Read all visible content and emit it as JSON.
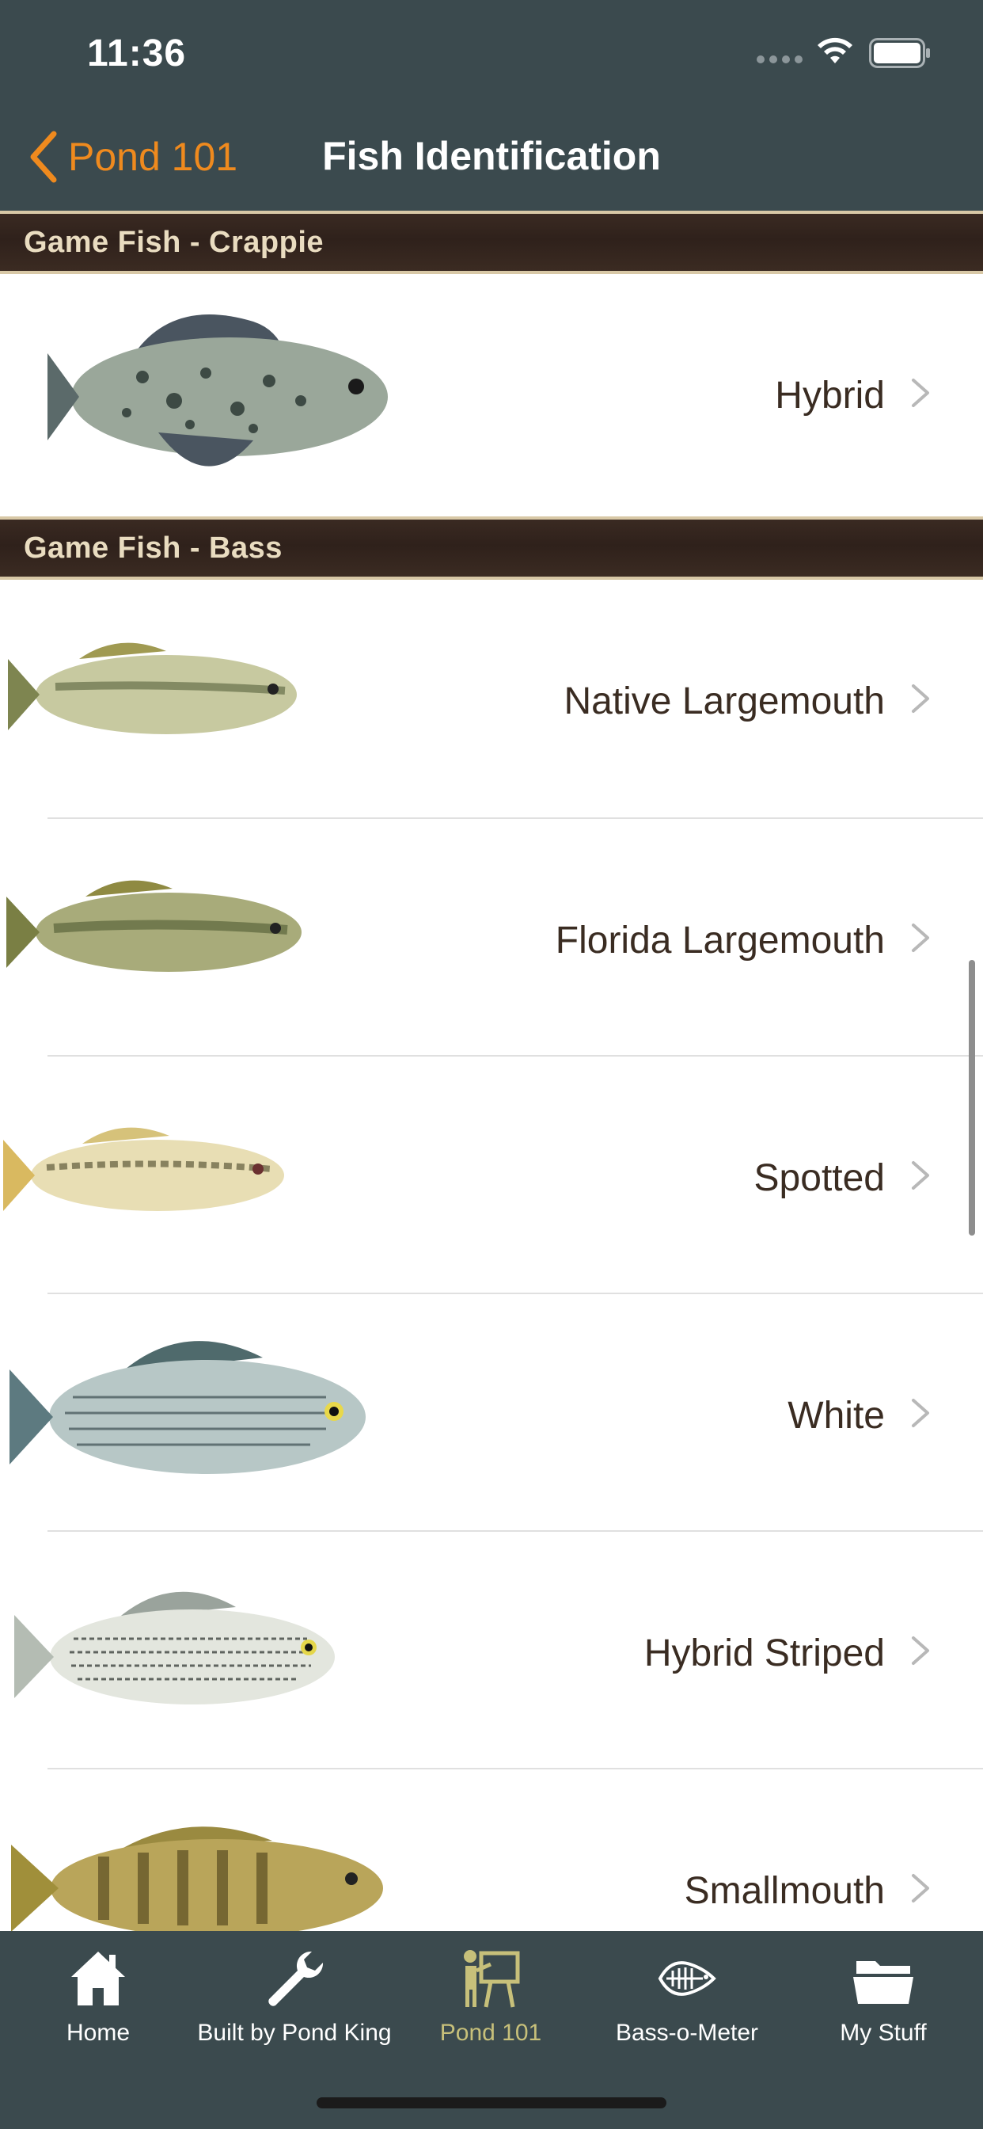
{
  "status_bar": {
    "time": "11:36"
  },
  "nav": {
    "back_label": "Pond 101",
    "title": "Fish Identification"
  },
  "sections": [
    {
      "title": "Game Fish - Crappie",
      "rows": [
        {
          "label": "Hybrid",
          "icon": "crappie-fish-image"
        }
      ]
    },
    {
      "title": "Game Fish - Bass",
      "rows": [
        {
          "label": "Native Largemouth",
          "icon": "largemouth-bass-image"
        },
        {
          "label": "Florida Largemouth",
          "icon": "florida-largemouth-image"
        },
        {
          "label": "Spotted",
          "icon": "spotted-bass-image"
        },
        {
          "label": "White",
          "icon": "white-bass-image"
        },
        {
          "label": "Hybrid Striped",
          "icon": "hybrid-striped-bass-image"
        },
        {
          "label": "Smallmouth",
          "icon": "smallmouth-bass-image"
        }
      ]
    }
  ],
  "tabs": [
    {
      "label": "Home",
      "icon": "home-icon"
    },
    {
      "label": "Built by Pond King",
      "icon": "wrench-icon"
    },
    {
      "label": "Pond 101",
      "icon": "teacher-board-icon",
      "active": true
    },
    {
      "label": "Bass-o-Meter",
      "icon": "bass-skeleton-icon"
    },
    {
      "label": "My Stuff",
      "icon": "folder-icon"
    }
  ],
  "colors": {
    "bar_bg": "#3b4a4e",
    "accent": "#ef8a1e",
    "active_tab": "#c7c07a",
    "section_text": "#e9dcc0"
  }
}
